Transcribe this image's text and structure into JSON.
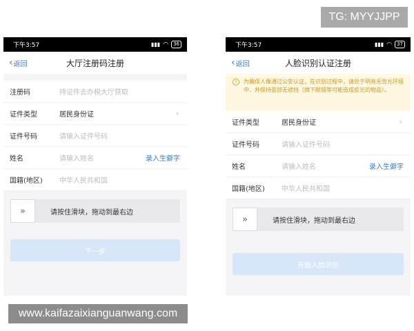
{
  "tg_badge": "TG: MYYJJPP",
  "watermark": "www.kaifazaixianguanwang.com",
  "colors": {
    "accent": "#3a7bd5",
    "button_disabled": "#d8e6fa",
    "notice_bg": "#fff8e1",
    "notice_text": "#c69a2b"
  },
  "left": {
    "status": {
      "time": "下午3:57",
      "battery": "36"
    },
    "nav": {
      "back": "返回",
      "title": "大厅注册码注册"
    },
    "rows": [
      {
        "label": "注册码",
        "placeholder": "持证件去办税大厅获取"
      },
      {
        "label": "证件类型",
        "value": "居民身份证"
      },
      {
        "label": "证件号码",
        "placeholder": "请输入证件号码"
      },
      {
        "label": "姓名",
        "placeholder": "请输入姓名",
        "link": "录入生僻字"
      },
      {
        "label": "国籍(地区)",
        "value": "中华人民共和国"
      }
    ],
    "slider_text": "请按住滑块，拖动到最右边",
    "button": "下一步"
  },
  "right": {
    "status": {
      "time": "下午3:57",
      "battery": "37"
    },
    "nav": {
      "back": "返回",
      "title": "人脸识别认证注册"
    },
    "notice": "为确保人像通过公安认证，在识别过程中，请处于明亮无背光环境中，并保持面部无遮挡（摘下眼镜等可能造成反光的物品）。",
    "rows": [
      {
        "label": "证件类型",
        "value": "居民身份证"
      },
      {
        "label": "证件号码",
        "placeholder": "请输入证件号码"
      },
      {
        "label": "姓名",
        "placeholder": "请输入姓名",
        "link": "录入生僻字"
      },
      {
        "label": "国籍(地区)",
        "value": "中华人民共和国"
      }
    ],
    "slider_text": "请按住滑块，拖动到最右边",
    "button": "开始人脸识别"
  }
}
